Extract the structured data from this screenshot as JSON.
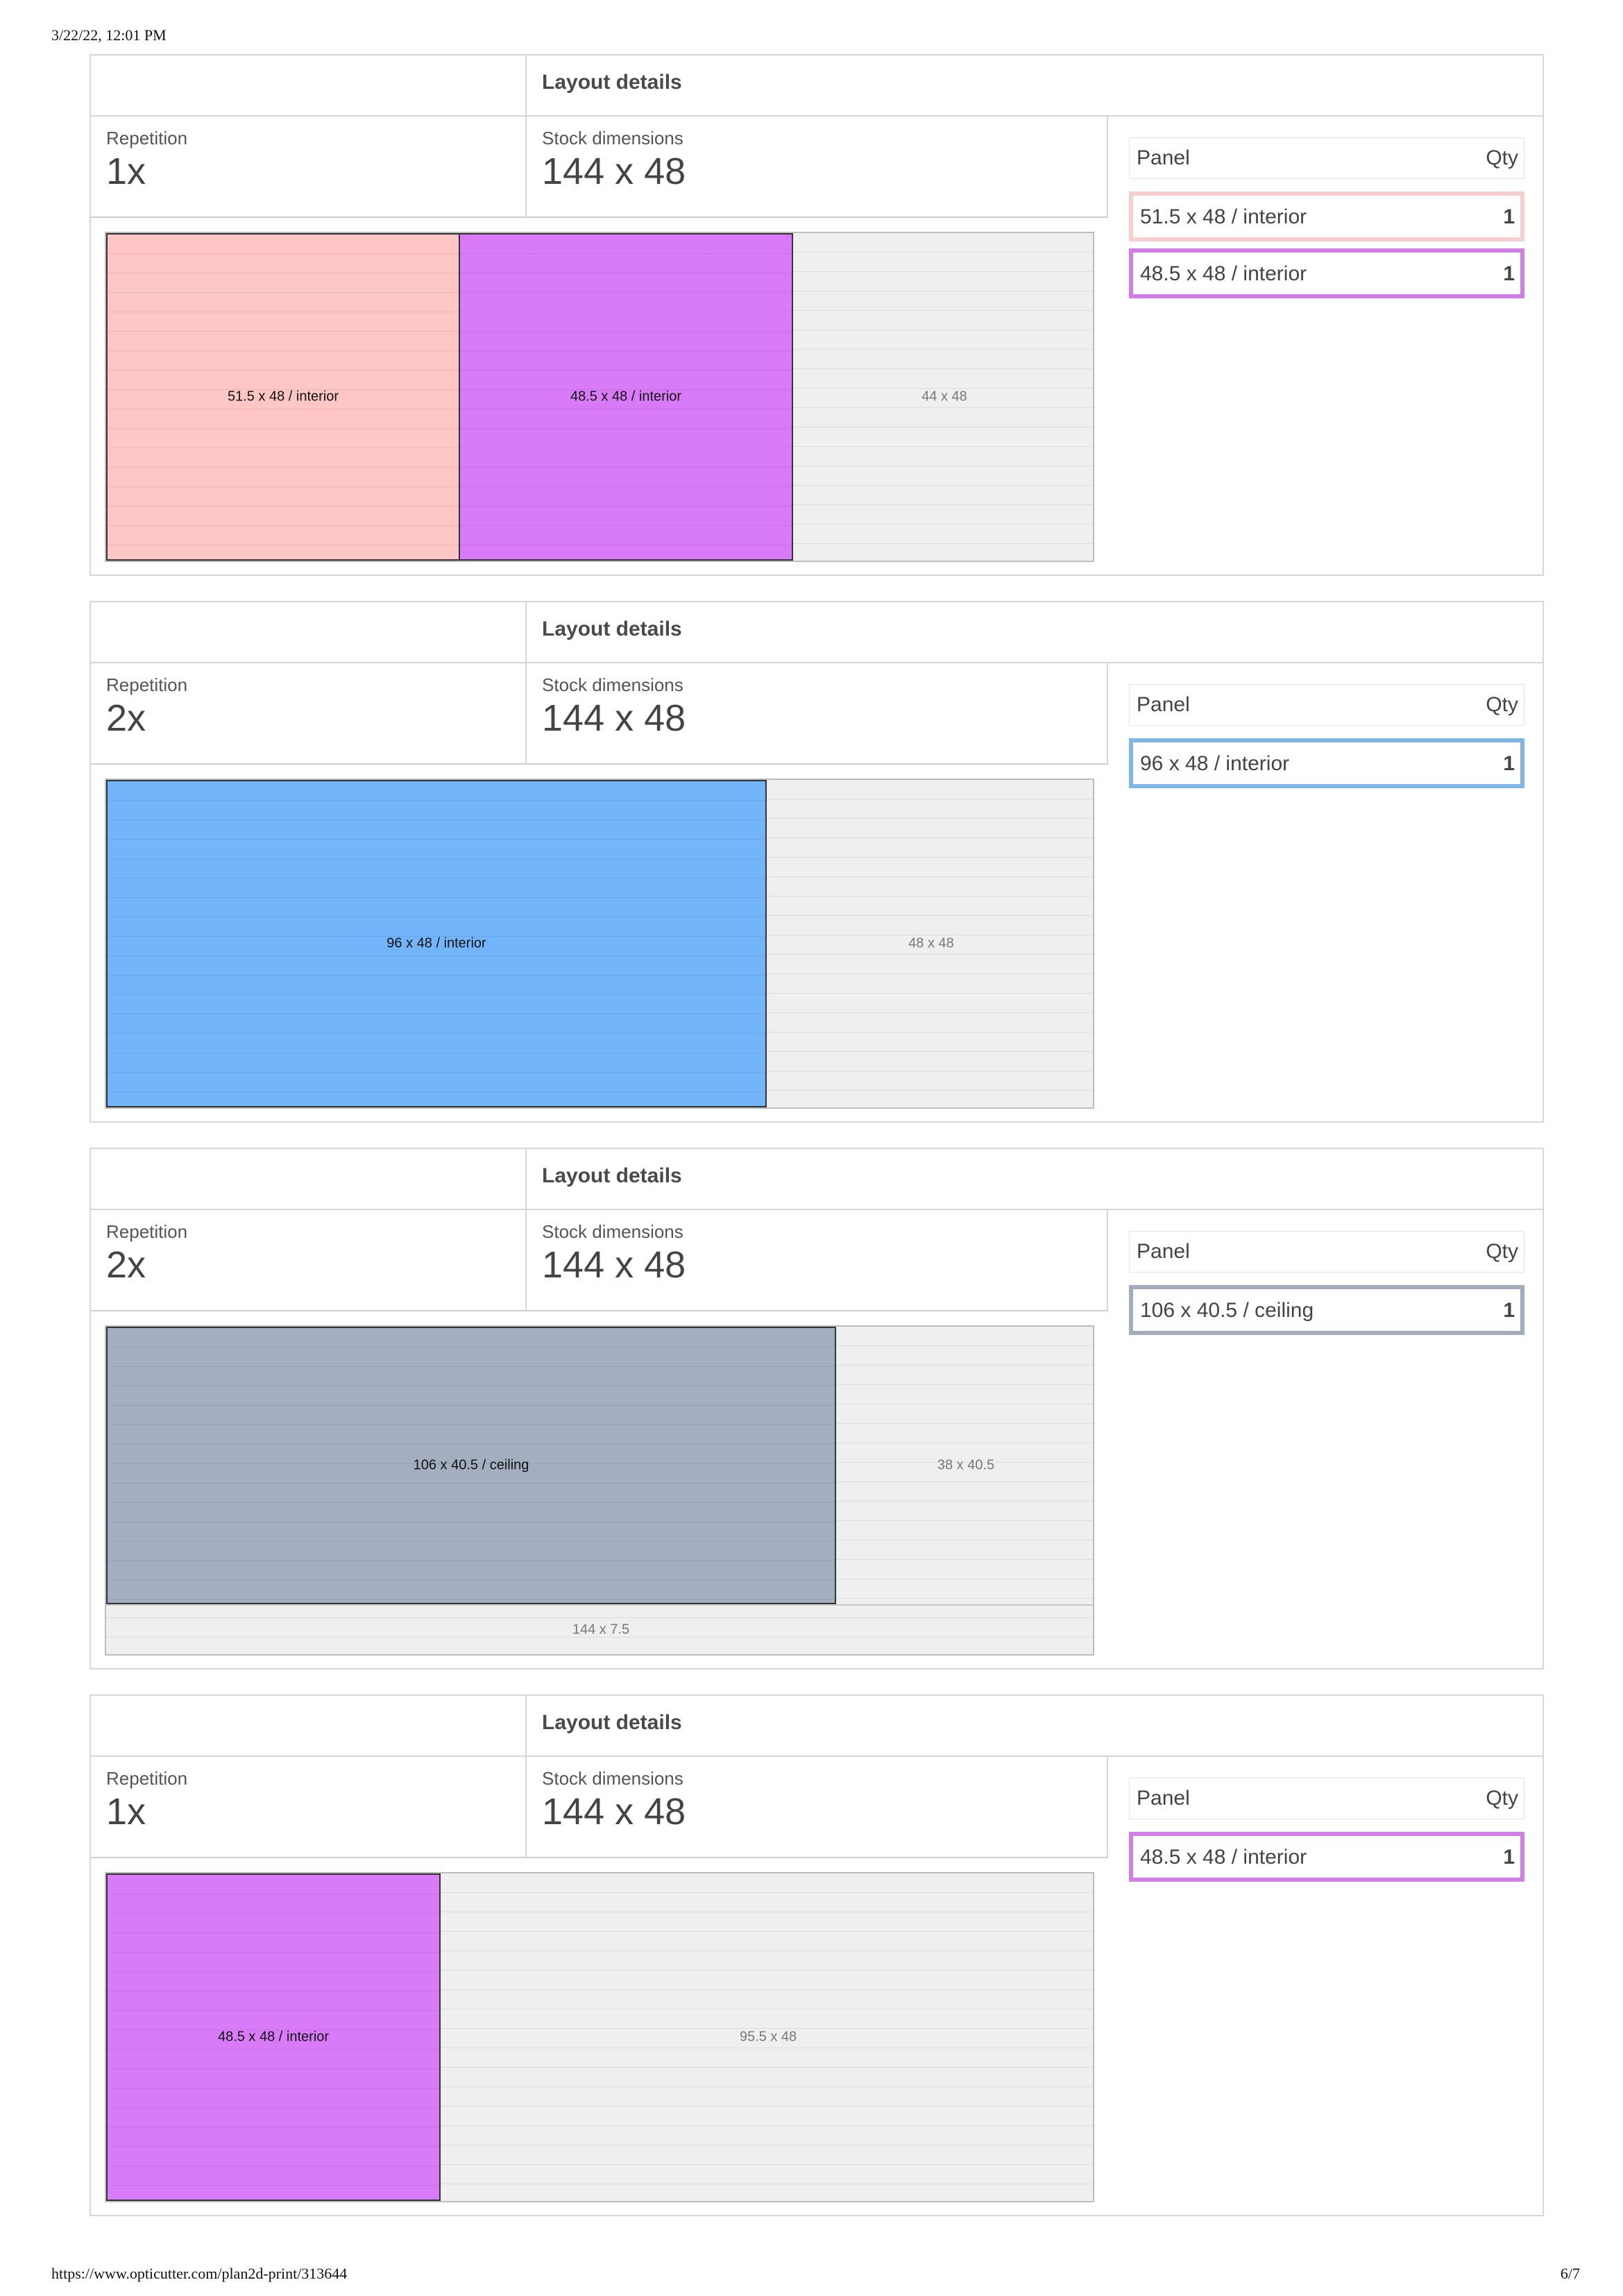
{
  "print": {
    "timestamp": "3/22/22, 12:01 PM",
    "url": "https://www.opticutter.com/plan2d-print/313644",
    "page": "6/7"
  },
  "layouts": [
    {
      "title": "Layout details",
      "repetition_label": "Repetition",
      "repetition": "1x",
      "stock_label": "Stock dimensions",
      "stock": "144 x 48",
      "panel_header": {
        "panel": "Panel",
        "qty": "Qty"
      },
      "panels": [
        {
          "label": "51.5 x 48 / interior",
          "qty": "1",
          "color": "#f6cfd3"
        },
        {
          "label": "48.5 x 48 / interior",
          "qty": "1",
          "color": "#d27ee9"
        }
      ],
      "pieces": [
        {
          "label": "51.5 x 48 / interior",
          "color": "#ffc6c6"
        },
        {
          "label": "48.5 x 48 / interior",
          "color": "#d97bf8"
        }
      ],
      "waste": [
        {
          "label": "44 x 48"
        }
      ]
    },
    {
      "title": "Layout details",
      "repetition_label": "Repetition",
      "repetition": "2x",
      "stock_label": "Stock dimensions",
      "stock": "144 x 48",
      "panel_header": {
        "panel": "Panel",
        "qty": "Qty"
      },
      "panels": [
        {
          "label": "96 x 48 / interior",
          "qty": "1",
          "color": "#7fb6e6"
        }
      ],
      "pieces": [
        {
          "label": "96 x 48 / interior",
          "color": "#72b5fb"
        }
      ],
      "waste": [
        {
          "label": "48 x 48"
        }
      ]
    },
    {
      "title": "Layout details",
      "repetition_label": "Repetition",
      "repetition": "2x",
      "stock_label": "Stock dimensions",
      "stock": "144 x 48",
      "panel_header": {
        "panel": "Panel",
        "qty": "Qty"
      },
      "panels": [
        {
          "label": "106 x 40.5 / ceiling",
          "qty": "1",
          "color": "#a2acbb"
        }
      ],
      "pieces": [
        {
          "label": "106 x 40.5 / ceiling",
          "color": "#a3aec0"
        }
      ],
      "waste": [
        {
          "label": "38 x 40.5"
        },
        {
          "label": "144 x 7.5"
        }
      ]
    },
    {
      "title": "Layout details",
      "repetition_label": "Repetition",
      "repetition": "1x",
      "stock_label": "Stock dimensions",
      "stock": "144 x 48",
      "panel_header": {
        "panel": "Panel",
        "qty": "Qty"
      },
      "panels": [
        {
          "label": "48.5 x 48 / interior",
          "qty": "1",
          "color": "#d27ee9"
        }
      ],
      "pieces": [
        {
          "label": "48.5 x 48 / interior",
          "color": "#d97bf8"
        }
      ],
      "waste": [
        {
          "label": "95.5 x 48"
        }
      ]
    }
  ]
}
